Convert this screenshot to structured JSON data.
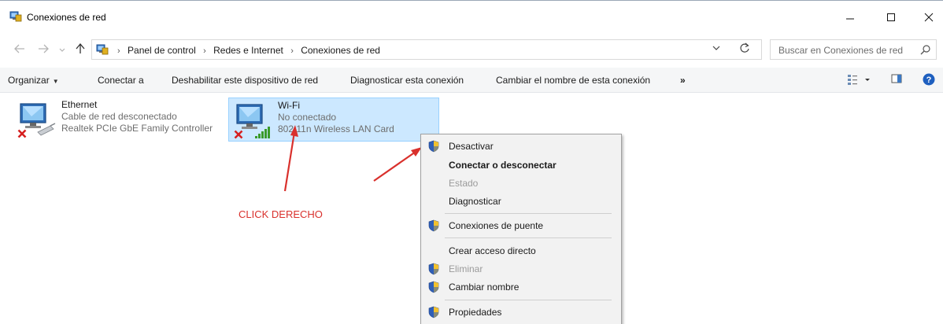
{
  "window": {
    "title": "Conexiones de red",
    "icon": "network-connections-icon"
  },
  "address": {
    "crumbs": [
      "Panel de control",
      "Redes e Internet",
      "Conexiones de red"
    ]
  },
  "search": {
    "placeholder": "Buscar en Conexiones de red"
  },
  "toolbar": {
    "organize": "Organizar",
    "connect_to": "Conectar a",
    "disable_device": "Deshabilitar este dispositivo de red",
    "diagnose": "Diagnosticar esta conexión",
    "rename": "Cambiar el nombre de esta conexión",
    "more": "»"
  },
  "connections": [
    {
      "name": "Ethernet",
      "status": "Cable de red desconectado",
      "adapter": "Realtek PCIe GbE Family Controller",
      "selected": false
    },
    {
      "name": "Wi-Fi",
      "status": "No conectado",
      "adapter": "802.11n Wireless LAN Card",
      "selected": true
    }
  ],
  "annotation": {
    "text": "CLICK DERECHO",
    "color": "#d9302c"
  },
  "context_menu": {
    "items": [
      {
        "label": "Desactivar",
        "shield": true,
        "bold": false,
        "disabled": false
      },
      {
        "label": "Conectar o desconectar",
        "shield": false,
        "bold": true,
        "disabled": false
      },
      {
        "label": "Estado",
        "shield": false,
        "bold": false,
        "disabled": true
      },
      {
        "label": "Diagnosticar",
        "shield": false,
        "bold": false,
        "disabled": false
      },
      {
        "label": "Conexiones de puente",
        "shield": true,
        "bold": false,
        "disabled": false
      },
      {
        "label": "Crear acceso directo",
        "shield": false,
        "bold": false,
        "disabled": false
      },
      {
        "label": "Eliminar",
        "shield": true,
        "bold": false,
        "disabled": true
      },
      {
        "label": "Cambiar nombre",
        "shield": true,
        "bold": false,
        "disabled": false
      },
      {
        "label": "Propiedades",
        "shield": true,
        "bold": false,
        "disabled": false
      }
    ]
  },
  "colors": {
    "selection_bg": "#cce8ff",
    "selection_border": "#99d1ff",
    "help_blue": "#1e5fbf",
    "error_red": "#d62020",
    "signal_green": "#3a9a2a"
  }
}
